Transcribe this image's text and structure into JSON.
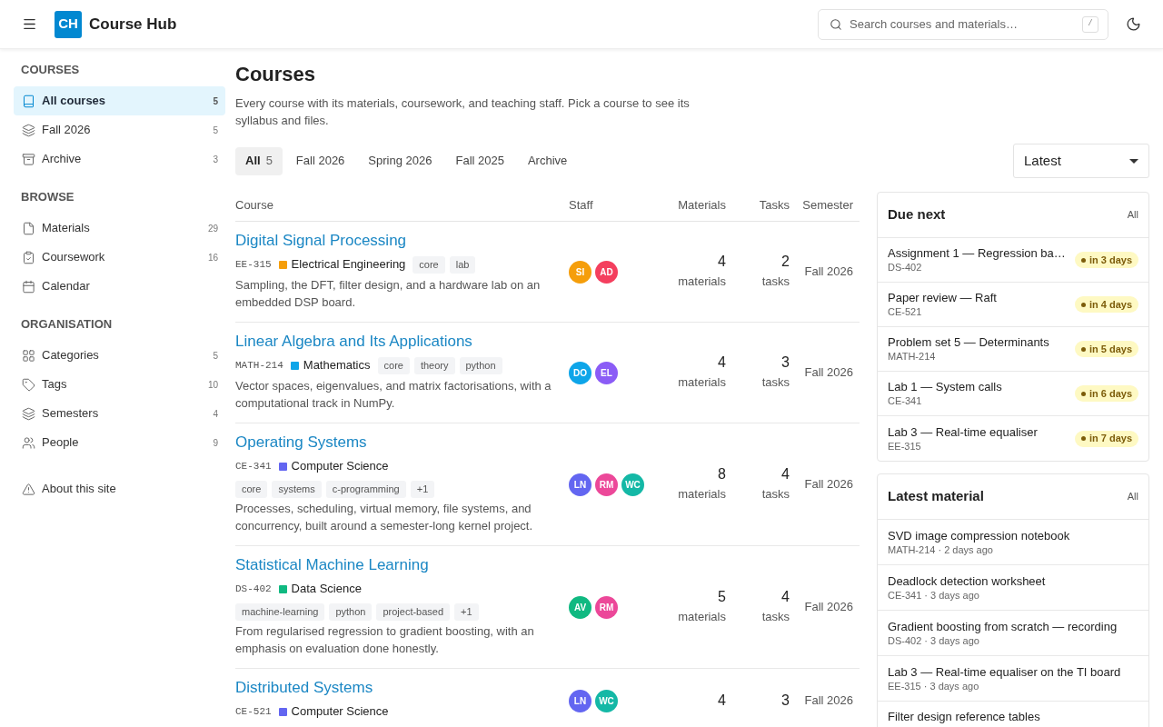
{
  "header": {
    "logo": "CH",
    "title": "Course Hub",
    "search": {
      "placeholder": "Search courses and materials…",
      "shortcut": "/"
    }
  },
  "sidebar": {
    "sections": [
      {
        "heading": "COURSES",
        "items": [
          {
            "label": "All courses",
            "count": "5",
            "selected": true
          },
          {
            "label": "Fall 2026",
            "count": "5",
            "selected": false
          },
          {
            "label": "Archive",
            "count": "3",
            "selected": false
          }
        ]
      },
      {
        "heading": "BROWSE",
        "items": [
          {
            "label": "Materials",
            "count": "29",
            "selected": false
          },
          {
            "label": "Coursework",
            "count": "16",
            "selected": false
          },
          {
            "label": "Calendar",
            "selected": false
          }
        ]
      },
      {
        "heading": "ORGANISATION",
        "items": [
          {
            "label": "Categories",
            "count": "5",
            "selected": false
          },
          {
            "label": "Tags",
            "count": "10",
            "selected": false
          },
          {
            "label": "Semesters",
            "count": "4",
            "selected": false
          },
          {
            "label": "People",
            "count": "9",
            "selected": false
          }
        ]
      }
    ],
    "footer": {
      "label": "About this site"
    }
  },
  "page": {
    "title": "Courses",
    "description": "Every course with its materials, coursework, and teaching staff. Pick a course to see its syllabus and files."
  },
  "tabs": [
    {
      "label": "All",
      "count": "5",
      "selected": true
    },
    {
      "label": "Fall 2026",
      "selected": false
    },
    {
      "label": "Spring 2026",
      "selected": false
    },
    {
      "label": "Fall 2025",
      "selected": false
    },
    {
      "label": "Archive",
      "selected": false
    }
  ],
  "sort": {
    "value": "Latest"
  },
  "table": {
    "columns": [
      "Course",
      "Staff",
      "Materials",
      "Tasks",
      "Semester"
    ],
    "rows": [
      {
        "title": "Digital Signal Processing",
        "code": "EE-315",
        "category": {
          "name": "Electrical Engineering",
          "color": "#f59e0b"
        },
        "tags": [
          "core",
          "lab"
        ],
        "description": "Sampling, the DFT, filter design, and a hardware lab on an embedded DSP board.",
        "staff": [
          {
            "initials": "SI",
            "color": "#f59e0b"
          },
          {
            "initials": "AD",
            "color": "#f43f5e"
          }
        ],
        "materials": "4",
        "materials_label": "materials",
        "tasks": "2",
        "tasks_label": "tasks",
        "semester": "Fall 2026"
      },
      {
        "title": "Linear Algebra and Its Applications",
        "code": "MATH-214",
        "category": {
          "name": "Mathematics",
          "color": "#0ea5e9"
        },
        "tags": [
          "core",
          "theory",
          "python"
        ],
        "description": "Vector spaces, eigenvalues, and matrix factorisations, with a computational track in NumPy.",
        "staff": [
          {
            "initials": "DO",
            "color": "#0ea5e9"
          },
          {
            "initials": "EL",
            "color": "#8b5cf6"
          }
        ],
        "materials": "4",
        "materials_label": "materials",
        "tasks": "3",
        "tasks_label": "tasks",
        "semester": "Fall 2026"
      },
      {
        "title": "Operating Systems",
        "code": "CE-341",
        "category": {
          "name": "Computer Science",
          "color": "#6366f1"
        },
        "tags": [
          "core",
          "systems",
          "c-programming",
          "+1"
        ],
        "description": "Processes, scheduling, virtual memory, file systems, and concurrency, built around a semester-long kernel project.",
        "staff": [
          {
            "initials": "LN",
            "color": "#6366f1"
          },
          {
            "initials": "RM",
            "color": "#ec4899"
          },
          {
            "initials": "WC",
            "color": "#14b8a6"
          }
        ],
        "materials": "8",
        "materials_label": "materials",
        "tasks": "4",
        "tasks_label": "tasks",
        "semester": "Fall 2026"
      },
      {
        "title": "Statistical Machine Learning",
        "code": "DS-402",
        "category": {
          "name": "Data Science",
          "color": "#10b981"
        },
        "tags": [
          "machine-learning",
          "python",
          "project-based",
          "+1"
        ],
        "description": "From regularised regression to gradient boosting, with an emphasis on evaluation done honestly.",
        "staff": [
          {
            "initials": "AV",
            "color": "#10b981"
          },
          {
            "initials": "RM",
            "color": "#ec4899"
          }
        ],
        "materials": "5",
        "materials_label": "materials",
        "tasks": "4",
        "tasks_label": "tasks",
        "semester": "Fall 2026"
      },
      {
        "title": "Distributed Systems",
        "code": "CE-521",
        "category": {
          "name": "Computer Science",
          "color": "#6366f1"
        },
        "staff": [
          {
            "initials": "LN",
            "color": "#6366f1"
          },
          {
            "initials": "WC",
            "color": "#14b8a6"
          }
        ],
        "materials": "4",
        "tasks": "3",
        "semester": "Fall 2026"
      }
    ]
  },
  "due_next": {
    "title": "Due next",
    "link": "All",
    "items": [
      {
        "title": "Assignment 1 — Regression ba…",
        "code": "DS-402",
        "due": "in 3 days"
      },
      {
        "title": "Paper review — Raft",
        "code": "CE-521",
        "due": "in 4 days"
      },
      {
        "title": "Problem set 5 — Determinants",
        "code": "MATH-214",
        "due": "in 5 days"
      },
      {
        "title": "Lab 1 — System calls",
        "code": "CE-341",
        "due": "in 6 days"
      },
      {
        "title": "Lab 3 — Real-time equaliser",
        "code": "EE-315",
        "due": "in 7 days"
      }
    ]
  },
  "latest_material": {
    "title": "Latest material",
    "link": "All",
    "items": [
      {
        "title": "SVD image compression notebook",
        "meta": "MATH-214 · 2 days ago"
      },
      {
        "title": "Deadlock detection worksheet",
        "meta": "CE-341 · 3 days ago"
      },
      {
        "title": "Gradient boosting from scratch — recording",
        "meta": "DS-402 · 3 days ago"
      },
      {
        "title": "Lab 3 — Real-time equaliser on the TI board",
        "meta": "EE-315 · 3 days ago"
      },
      {
        "title": "Filter design reference tables"
      }
    ]
  }
}
